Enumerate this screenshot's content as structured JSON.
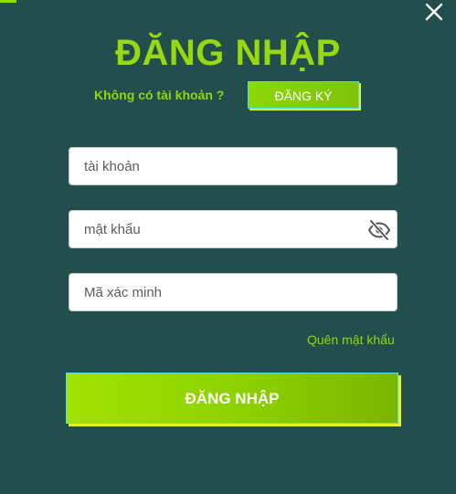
{
  "dialog": {
    "title": "ĐĂNG NHẬP",
    "no_account_text": "Không có tài khoản ?",
    "register_label": "ĐĂNG KÝ",
    "close_icon": "close-icon"
  },
  "form": {
    "username": {
      "placeholder": "tài khoản",
      "value": ""
    },
    "password": {
      "placeholder": "mật khẩu",
      "value": "",
      "toggle_icon": "eye-slash-icon"
    },
    "captcha": {
      "placeholder": "Mã xác minh",
      "value": ""
    },
    "forgot_label": "Quên mật khẩu",
    "submit_label": "ĐĂNG NHẬP"
  },
  "colors": {
    "background": "#224f4d",
    "accent": "#97d80f",
    "button_border": "#4ee0e6",
    "button_shadow": "#e7ef28"
  }
}
